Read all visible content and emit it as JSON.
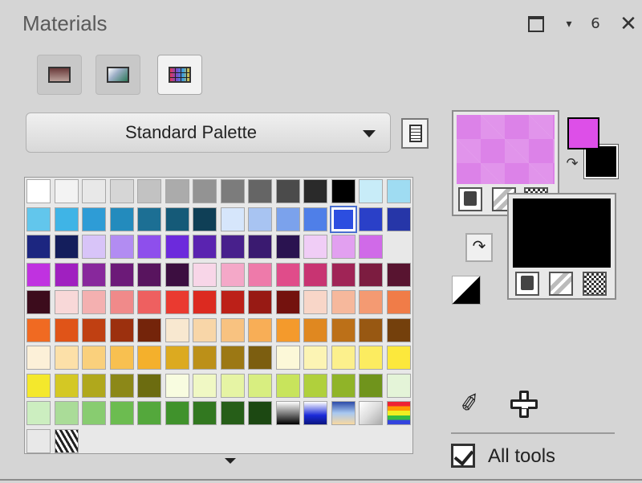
{
  "panel": {
    "title": "Materials",
    "controls": {
      "restore_icon": "restore-icon",
      "menu_icon": "▾",
      "pin_icon": "ᵻ",
      "close_icon": "✕"
    }
  },
  "tabs": [
    {
      "id": "color",
      "icon": "color-swatch-icon",
      "active": false
    },
    {
      "id": "gradient",
      "icon": "gradient-icon",
      "active": false
    },
    {
      "id": "swatches",
      "icon": "swatch-grid-icon",
      "active": true
    }
  ],
  "palette_selector": {
    "selected": "Standard Palette"
  },
  "swatches": {
    "rows": [
      [
        "#ffffff",
        "#f3f3f3",
        "#e8e8e8",
        "#d6d6d6",
        "#c2c2c2",
        "#ababab",
        "#939393",
        "#7c7c7c",
        "#656565",
        "#4b4b4b",
        "#2a2a2a",
        "#000000",
        "#c8ecf8",
        "#9fdcf2"
      ],
      [
        "#62c6ec",
        "#3fb4e6",
        "#2e9cd6",
        "#238bbd",
        "#1c6f94",
        "#155a78",
        "#0f3f56",
        "#d6e6fb",
        "#a8c4f2",
        "#7ba2ec",
        "#4f7fe8",
        "#2c4ee0",
        "#2a40c8",
        "#2636a8"
      ],
      [
        "#1c2680",
        "#141e5c",
        "#d8c4f8",
        "#b28cf2",
        "#8e4fec",
        "#6c2adc",
        "#5a23b0",
        "#48208c",
        "#3a1a70",
        "#2a1350",
        "#f0cdf6",
        "#e2a0f0",
        "#d06ae8"
      ],
      [
        "#c032e0",
        "#a020c0",
        "#88289c",
        "#6c1a78",
        "#58145e",
        "#3c0e40",
        "#f8d6e8",
        "#f4a8c8",
        "#ee7aaa",
        "#e04c8a",
        "#c83472",
        "#a02456",
        "#7c1c40",
        "#581430"
      ],
      [
        "#3c0c1c",
        "#f8d8d8",
        "#f4b0b0",
        "#f08a8a",
        "#ee6060",
        "#ea3a30",
        "#dc2a20",
        "#bc2018",
        "#981a14",
        "#74120e",
        "#f8d6c8",
        "#f6b89c",
        "#f49a72",
        "#f07c48"
      ],
      [
        "#f06a22",
        "#e05418",
        "#c04012",
        "#9c300e",
        "#74240a",
        "#f8e8d0",
        "#f8d6a8",
        "#f8c280",
        "#f8ae56",
        "#f49a2c",
        "#e08820",
        "#bc7018",
        "#985812",
        "#74400c"
      ],
      [
        "#fcf0d8",
        "#fce0a8",
        "#fad07c",
        "#f8c050",
        "#f4b02c",
        "#dcaa20",
        "#bc9018",
        "#9c7814",
        "#7c5e10",
        "#fcf8d8",
        "#fcf4b4",
        "#fcf08c",
        "#fcec60",
        "#fce83c"
      ],
      [
        "#f4e82c",
        "#d4c824",
        "#b0a81c",
        "#8c8818",
        "#6c6c10",
        "#f8fce0",
        "#f0f8c4",
        "#e6f4a4",
        "#d8ee80",
        "#c8e45c",
        "#b0d03c",
        "#90b428",
        "#70941c",
        "#e4f4d8"
      ],
      [
        "#cceec0",
        "#aadc98",
        "#88cc70",
        "#6cbc50",
        "#54a83c",
        "#40922c",
        "#327820",
        "#265e18",
        "#1c4812",
        "gradient-black-white",
        "gradient-blue",
        "gradient-sky",
        "gradient-gray",
        "gradient-rainbow",
        "gradient-metal"
      ],
      [
        "#e8e8e8",
        "pattern-zebra"
      ]
    ],
    "selected": {
      "row": 1,
      "col": 11
    }
  },
  "materials": {
    "foreground_color": "#dc82e8",
    "foreground_small_color": "#dd4fe8",
    "background_color": "#000000",
    "swap_icon": "↷",
    "mini_buttons": [
      "color-mode-icon",
      "gradient-mode-icon",
      "pattern-mode-icon"
    ]
  },
  "tools": {
    "dropper_icon": "✐",
    "add_icon": "plus-outline-icon"
  },
  "all_tools": {
    "label": "All tools",
    "checked": true
  }
}
